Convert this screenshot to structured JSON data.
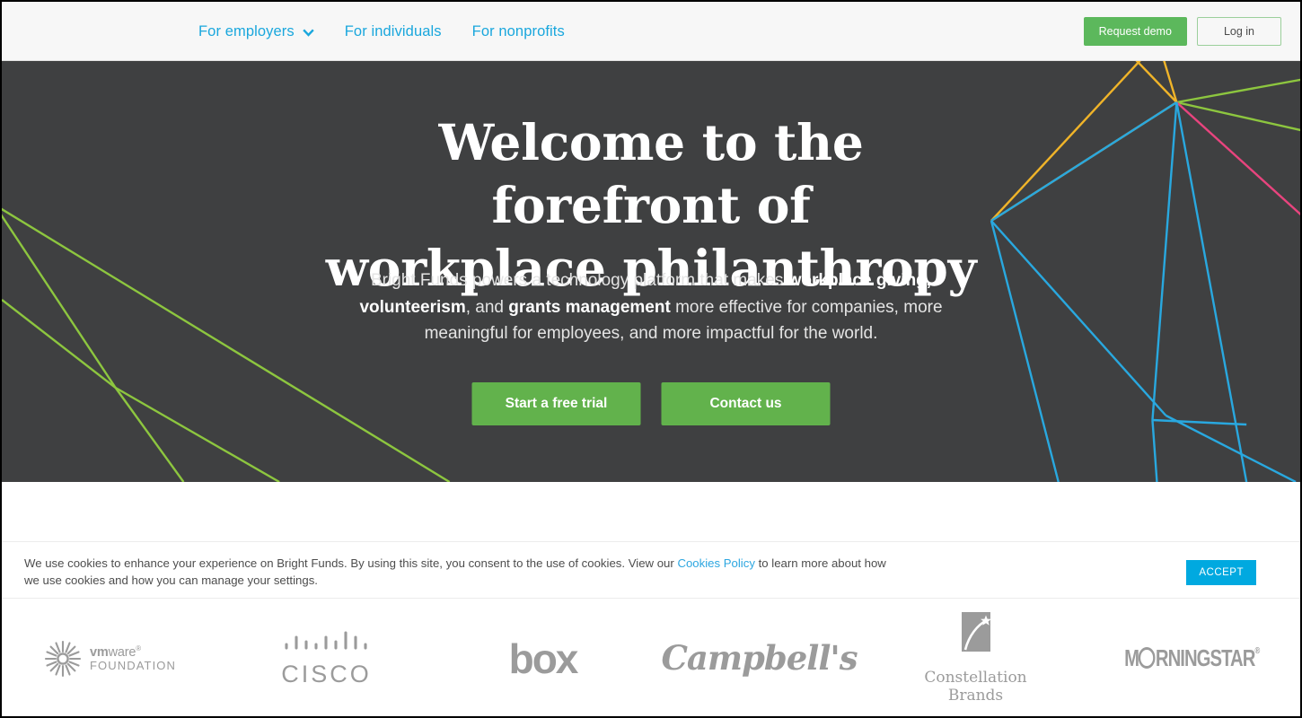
{
  "header": {
    "nav": [
      {
        "label": "For employers",
        "has_dropdown": true,
        "icon": "chevron-down-icon"
      },
      {
        "label": "For individuals",
        "has_dropdown": false
      },
      {
        "label": "For nonprofits",
        "has_dropdown": false
      }
    ],
    "request_demo_label": "Request demo",
    "login_label": "Log in",
    "nav_link_color": "#1aa7dd",
    "background": "#f7f7f7",
    "demo_button_color": "#5cb85c"
  },
  "hero": {
    "title_line1": "Welcome to the forefront of",
    "title_line2": "workplace philanthropy",
    "subtitle": {
      "part1": "Bright Funds powers a technology platform that makes ",
      "bold1": "workplace giving,",
      "part2": " ",
      "bold2": "volunteerism",
      "part3": ", and ",
      "bold3": "grants management",
      "part4": " more effective for companies, more meaningful for employees, and more impactful for the world."
    },
    "cta_primary": "Start a free trial",
    "cta_secondary": "Contact us",
    "background": "#3f4041",
    "cta_color": "#62b24c",
    "art_colors": {
      "cyan": "#29a8df",
      "yellow": "#f0b429",
      "green": "#8dc63f",
      "pink": "#e8447e"
    }
  },
  "cookie_banner": {
    "text_part1": "We use cookies to enhance your experience on Bright Funds. By using this site, you consent to the use of cookies. View our ",
    "link_label": "Cookies Policy",
    "text_part2": " to learn more about how we use cookies and how you can manage your settings.",
    "accept_label": "ACCEPT",
    "accept_color": "#00a9e0",
    "link_color": "#2ca6e0"
  },
  "logos": {
    "color": "#9b9b9b",
    "items": [
      {
        "name": "vmware-foundation",
        "line1_bold": "vm",
        "line1_rest": "ware",
        "line1_mark": "®",
        "line2": "FOUNDATION"
      },
      {
        "name": "cisco",
        "wordmark": "CISCO"
      },
      {
        "name": "box",
        "wordmark": "box"
      },
      {
        "name": "campbells",
        "wordmark": "Campbell's"
      },
      {
        "name": "constellation-brands",
        "line1": "Constellation",
        "line2": "Brands"
      },
      {
        "name": "morningstar",
        "prefix": "M",
        "suffix": "RNINGSTAR",
        "mark": "®"
      }
    ]
  }
}
